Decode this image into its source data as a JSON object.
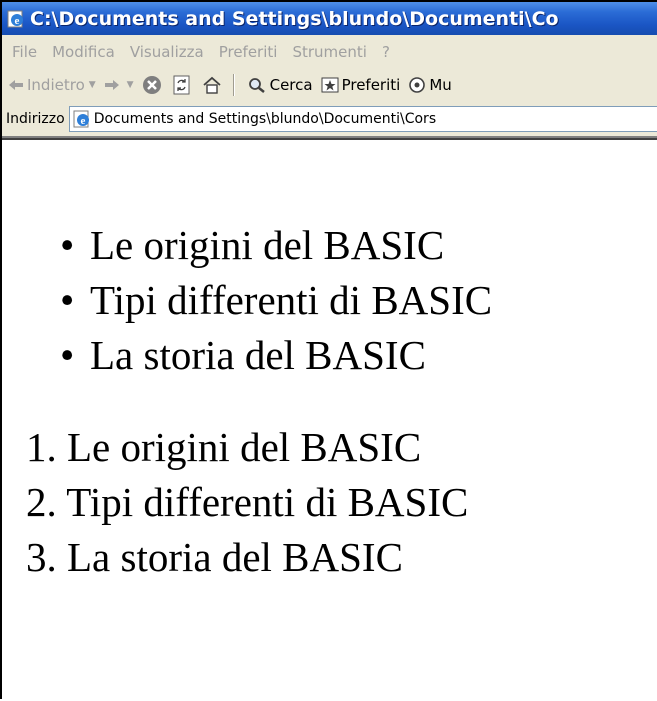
{
  "window": {
    "title": "C:\\Documents and Settings\\blundo\\Documenti\\Co"
  },
  "menubar": {
    "items": [
      "File",
      "Modifica",
      "Visualizza",
      "Preferiti",
      "Strumenti",
      "?"
    ]
  },
  "toolbar": {
    "back_label": "Indietro",
    "search_label": "Cerca",
    "favorites_label": "Preferiti",
    "media_label": "Mu"
  },
  "address": {
    "label": "Indirizzo",
    "value": "Documents and Settings\\blundo\\Documenti\\Cors"
  },
  "content": {
    "bullet_items": [
      "Le origini del BASIC",
      "Tipi differenti di BASIC",
      "La storia del BASIC"
    ],
    "numbered_items": [
      {
        "num": "1.",
        "text": "Le origini del BASIC"
      },
      {
        "num": "2.",
        "text": "Tipi differenti di BASIC"
      },
      {
        "num": "3.",
        "text": "La storia del BASIC"
      }
    ]
  },
  "colors": {
    "titlebar": "#1a55c4",
    "chrome": "#ece9d8",
    "disabled_text": "#a0a0a0"
  }
}
